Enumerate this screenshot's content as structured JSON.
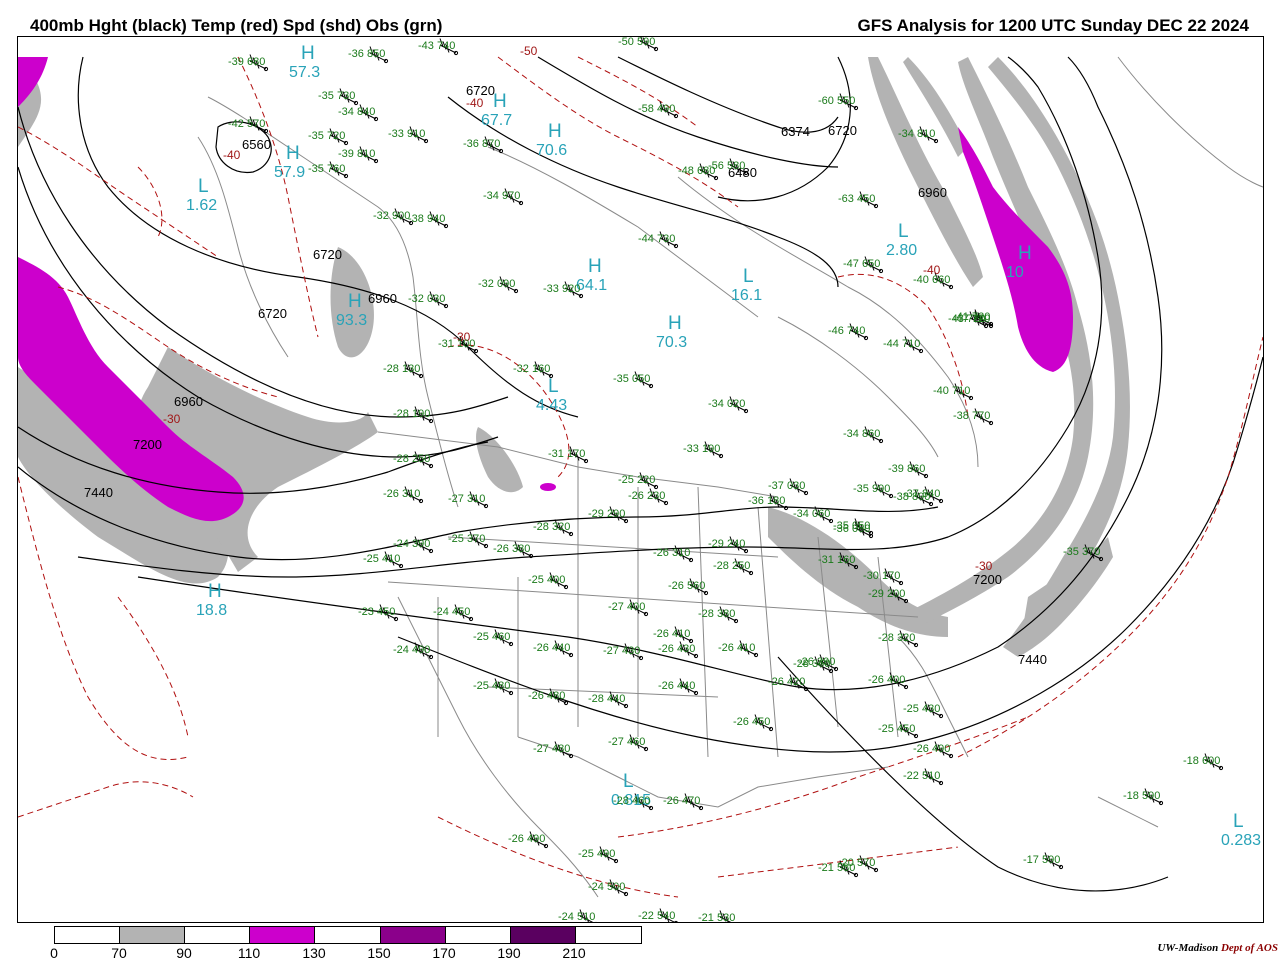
{
  "title": {
    "left": "400mb Hght (black) Temp (red) Spd (shd) Obs (grn)",
    "right": "GFS Analysis for 1200 UTC Sunday  DEC 22 2024"
  },
  "colors": {
    "height_contour": "#000000",
    "temp_contour": "#b01010",
    "obs_text": "#1a7a1a",
    "pressure_center_text": "#29a3b8",
    "border_lines": "#8a8a8a",
    "speed_70_90": "#b3b3b3",
    "speed_110_130": "#cc00cc",
    "speed_150_170": "#8b008b",
    "speed_190_210": "#5a0060"
  },
  "contour_labels": [
    "6720",
    "6720",
    "6720",
    "6720",
    "6960",
    "6960",
    "6960",
    "6560",
    "6374",
    "6480",
    "7200",
    "7200",
    "7440",
    "7440"
  ],
  "temp_labels": [
    "-30",
    "-40",
    "-40",
    "-50",
    "-30",
    "-30",
    "-40"
  ],
  "pressure_centers": [
    {
      "letter": "H",
      "value": "57.3"
    },
    {
      "letter": "H",
      "value": "57.9"
    },
    {
      "letter": "L",
      "value": "1.62"
    },
    {
      "letter": "H",
      "value": "67.7"
    },
    {
      "letter": "H",
      "value": "70.6"
    },
    {
      "letter": "H",
      "value": "64.1"
    },
    {
      "letter": "L",
      "value": "16.1"
    },
    {
      "letter": "H",
      "value": "70.3"
    },
    {
      "letter": "H",
      "value": "93.3"
    },
    {
      "letter": "L",
      "value": "4.43"
    },
    {
      "letter": "L",
      "value": "2.80"
    },
    {
      "letter": "L",
      "value": "0.815"
    },
    {
      "letter": "L",
      "value": "0.283"
    },
    {
      "letter": "H",
      "value": "18.8"
    },
    {
      "letter": "H",
      "value": "10"
    }
  ],
  "observations": [
    "-39 680",
    "-42 570",
    "-35 730",
    "-34 840",
    "-33 910",
    "-36 850",
    "-35 720",
    "-35 760",
    "-39 810",
    "-38 940",
    "-32 900",
    "-34 970",
    "-36 870",
    "-32 090",
    "-33 920",
    "-31 100",
    "-32 030",
    "-32 160",
    "-31 170",
    "-35 050",
    "-34 020",
    "-33 190",
    "-28 130",
    "-28 190",
    "-28 250",
    "-26 310",
    "-27 310",
    "-28 320",
    "-29 290",
    "-24 390",
    "-25 370",
    "-25 410",
    "-26 380",
    "-25 400",
    "-26 440",
    "-23 450",
    "-24 450",
    "-24 490",
    "-25 460",
    "-25 480",
    "-26 480",
    "-27 480",
    "-27 460",
    "-26 440",
    "-27 430",
    "-26 430",
    "-28 440",
    "-28 460",
    "-26 470",
    "-26 490",
    "-25 490",
    "-24 500",
    "-24 510",
    "-22 540",
    "-21 530",
    "-21 580",
    "-20 570",
    "-17 590",
    "-18 590",
    "-18 600",
    "-22 510",
    "-26 490",
    "-25 450",
    "-25 430",
    "-26 400",
    "-26 390",
    "-26 410",
    "-26 420",
    "-26 450",
    "-28 360",
    "-28 320",
    "-29 200",
    "-30 170",
    "-31 160",
    "-29 240",
    "-28 250",
    "-26 310",
    "-27 400",
    "-28 380",
    "-26 410",
    "-26 560",
    "-25 220",
    "-26 230",
    "-36 180",
    "-37 030",
    "-34 060",
    "-36 050",
    "-35 050",
    "-35 990",
    "-39 860",
    "-38 890",
    "-37 840",
    "-35 370",
    "-40 710",
    "-44 710",
    "-47 720",
    "-46 740",
    "-47 650",
    "-40 660",
    "-43 720",
    "-44 730",
    "-48 680",
    "-63 450",
    "-60 550",
    "-56 580",
    "-58 490",
    "-34 810",
    "-43 740",
    "-50 590",
    "-38 770",
    "-41 720",
    "-34 860"
  ],
  "colorbar": {
    "ticks": [
      "0",
      "70",
      "90",
      "110",
      "130",
      "150",
      "170",
      "190",
      "210"
    ]
  },
  "credit": {
    "org": "UW-Madison",
    "dept": "Dept of AOS"
  }
}
